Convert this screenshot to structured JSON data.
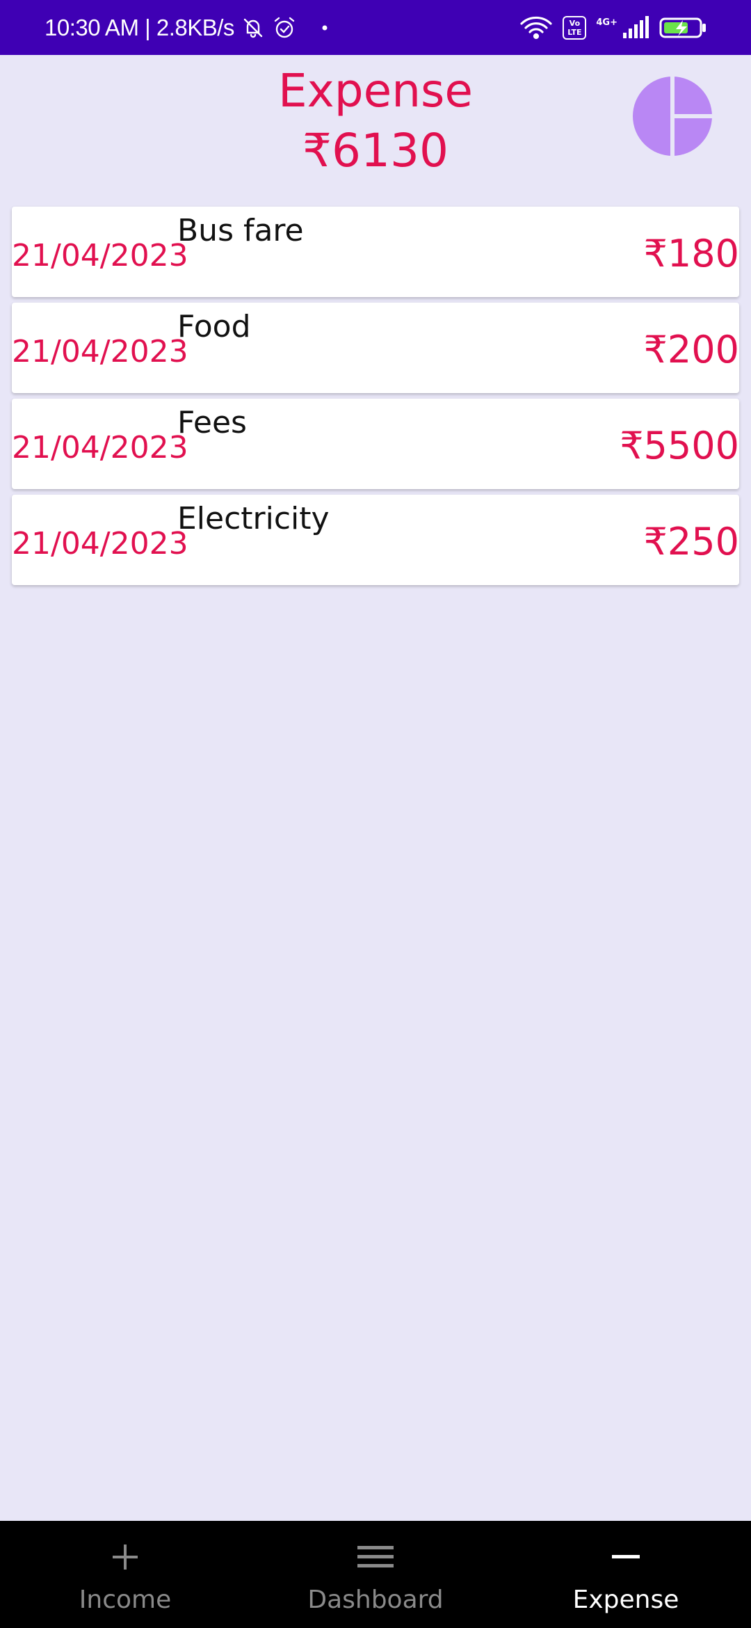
{
  "status_bar": {
    "time_speed": "10:30 AM | 2.8KB/s",
    "volte_label": "Vo LTE",
    "network_label": "4G+",
    "icons": [
      "bell-muted-icon",
      "alarm-icon",
      "dot-icon",
      "wifi-icon",
      "volte-icon",
      "signal-icon",
      "battery-charging-icon"
    ]
  },
  "header": {
    "title": "Expense",
    "total": "₹6130",
    "chart_icon": "pie-chart-icon"
  },
  "expenses": [
    {
      "date": "21/04/2023",
      "name": "Bus fare",
      "amount": "₹180"
    },
    {
      "date": "21/04/2023",
      "name": "Food",
      "amount": "₹200"
    },
    {
      "date": "21/04/2023",
      "name": "Fees",
      "amount": "₹5500"
    },
    {
      "date": "21/04/2023",
      "name": "Electricity",
      "amount": "₹250"
    }
  ],
  "bottom_nav": {
    "items": [
      {
        "label": "Income",
        "icon": "plus-icon",
        "active": false
      },
      {
        "label": "Dashboard",
        "icon": "menu-icon",
        "active": false
      },
      {
        "label": "Expense",
        "icon": "minus-icon",
        "active": true
      }
    ]
  },
  "colors": {
    "status_bar": "#3F00B4",
    "background": "#E8E6F7",
    "accent": "#E1104F",
    "chart_icon": "#B987F4",
    "nav_bar": "#000000"
  }
}
